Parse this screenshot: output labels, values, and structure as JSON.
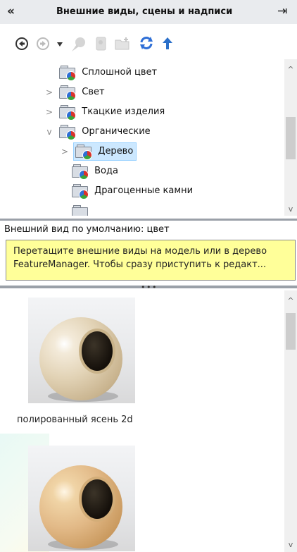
{
  "header": {
    "title": "Внешние виды, сцены и надписи",
    "collapse_icon": "«",
    "pin_icon": "⇥"
  },
  "toolbar": {
    "back": "back-icon",
    "forward": "forward-icon",
    "dropdown": "dropdown-arrow-icon",
    "add_to_favorites": "add-appearance-icon",
    "generate": "generate-icon",
    "new_folder": "new-folder-icon",
    "refresh": "refresh-icon",
    "up": "up-folder-icon"
  },
  "tree": {
    "items": [
      {
        "label": "Сплошной цвет",
        "expander": ""
      },
      {
        "label": "Свет",
        "expander": ">"
      },
      {
        "label": "Ткацкие изделия",
        "expander": ">"
      },
      {
        "label": "Органические",
        "expander": "v"
      },
      {
        "label": "Дерево",
        "expander": ">",
        "selected": true
      },
      {
        "label": "Вода",
        "expander": ""
      },
      {
        "label": "Драгоценные камни",
        "expander": ""
      }
    ],
    "scroll_up": "^",
    "scroll_down": "v"
  },
  "status": {
    "default_appearance": "Внешний вид по умолчанию: цвет"
  },
  "tooltip": {
    "line1": "Перетащите внешние виды на модель или в дерево",
    "line2": "FeatureManager.  Чтобы сразу приступить к редакт..."
  },
  "splitter": {
    "grip": "• • •"
  },
  "gallery": {
    "items": [
      {
        "caption": "полированный ясень 2d",
        "color": "#e2d3b6"
      },
      {
        "caption": "",
        "color": "#e6c28e"
      }
    ],
    "scroll_up": "^",
    "scroll_down": "v"
  },
  "colors": {
    "selection": "#cce8ff",
    "tooltip_bg": "#ffff99",
    "header_bg": "#e9ebee"
  }
}
